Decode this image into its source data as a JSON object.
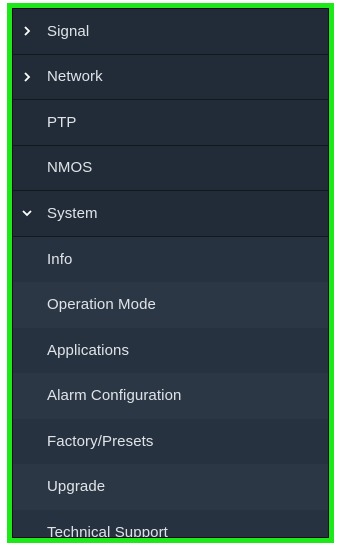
{
  "menu": {
    "items": [
      {
        "label": "Signal",
        "type": "section",
        "state": "collapsed",
        "icon": "chevron-right-icon"
      },
      {
        "label": "Network",
        "type": "section",
        "state": "collapsed",
        "icon": "chevron-right-icon"
      },
      {
        "label": "PTP",
        "type": "section"
      },
      {
        "label": "NMOS",
        "type": "section"
      },
      {
        "label": "System",
        "type": "section",
        "state": "expanded",
        "icon": "chevron-down-icon"
      },
      {
        "label": "Info",
        "type": "child"
      },
      {
        "label": "Operation Mode",
        "type": "child"
      },
      {
        "label": "Applications",
        "type": "child"
      },
      {
        "label": "Alarm Configuration",
        "type": "child"
      },
      {
        "label": "Factory/Presets",
        "type": "child"
      },
      {
        "label": "Upgrade",
        "type": "child"
      },
      {
        "label": "Technical Support",
        "type": "child"
      }
    ]
  },
  "colors": {
    "highlight_border": "#1ee81a",
    "panel_bg": "#1f2937",
    "text": "#dfe3e8"
  }
}
